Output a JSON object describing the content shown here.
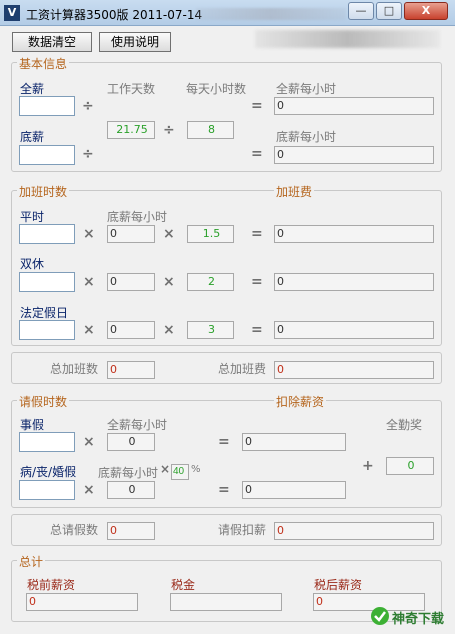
{
  "window": {
    "title": "工资计算器3500版  2011-07-14",
    "min_label": "—",
    "max_label": "□",
    "close_label": "X"
  },
  "toolbar": {
    "clear_label": "数据清空",
    "help_label": "使用说明"
  },
  "basic": {
    "group_title": "基本信息",
    "full_salary_label": "全薪",
    "full_salary_value": "",
    "base_salary_label": "底薪",
    "base_salary_value": "",
    "work_days_label": "工作天数",
    "work_days_value": "21.75",
    "hours_per_day_label": "每天小时数",
    "hours_per_day_value": "8",
    "full_hourly_label": "全薪每小时",
    "full_hourly_value": "0",
    "base_hourly_label": "底薪每小时",
    "base_hourly_value": "0"
  },
  "overtime": {
    "group_title": "加班时数",
    "fee_title": "加班费",
    "base_hourly_label": "底薪每小时",
    "rows": [
      {
        "label": "平时",
        "value": "",
        "base": "0",
        "mult": "1.5",
        "result": "0"
      },
      {
        "label": "双休",
        "value": "",
        "base": "0",
        "mult": "2",
        "result": "0"
      },
      {
        "label": "法定假日",
        "value": "",
        "base": "0",
        "mult": "3",
        "result": "0"
      }
    ],
    "total_hours_label": "总加班数",
    "total_hours_value": "0",
    "total_fee_label": "总加班费",
    "total_fee_value": "0"
  },
  "leave": {
    "group_title": "请假时数",
    "deduct_title": "扣除薪资",
    "personal_label": "事假",
    "personal_value": "",
    "full_hourly_label": "全薪每小时",
    "full_hourly_value": "0",
    "personal_result": "0",
    "sick_label": "病/丧/婚假",
    "sick_value": "",
    "base_hourly_label": "底薪每小时",
    "pct_value": "40",
    "pct_sign": "%",
    "sick_base": "0",
    "sick_result": "0",
    "bonus_label": "全勤奖",
    "bonus_value": "0",
    "total_hours_label": "总请假数",
    "total_hours_value": "0",
    "total_deduct_label": "请假扣薪",
    "total_deduct_value": "0"
  },
  "total": {
    "group_title": "总计",
    "pretax_label": "税前薪资",
    "pretax_value": "0",
    "tax_label": "税金",
    "tax_value": "",
    "aftertax_label": "税后薪资",
    "aftertax_value": "0"
  },
  "watermark": {
    "text": "神奇下载"
  },
  "colors": {
    "title_bar": "#b9d1ea",
    "group_title": "#b5651d",
    "green_value": "#2aa02a",
    "red_value": "#c0301a"
  }
}
